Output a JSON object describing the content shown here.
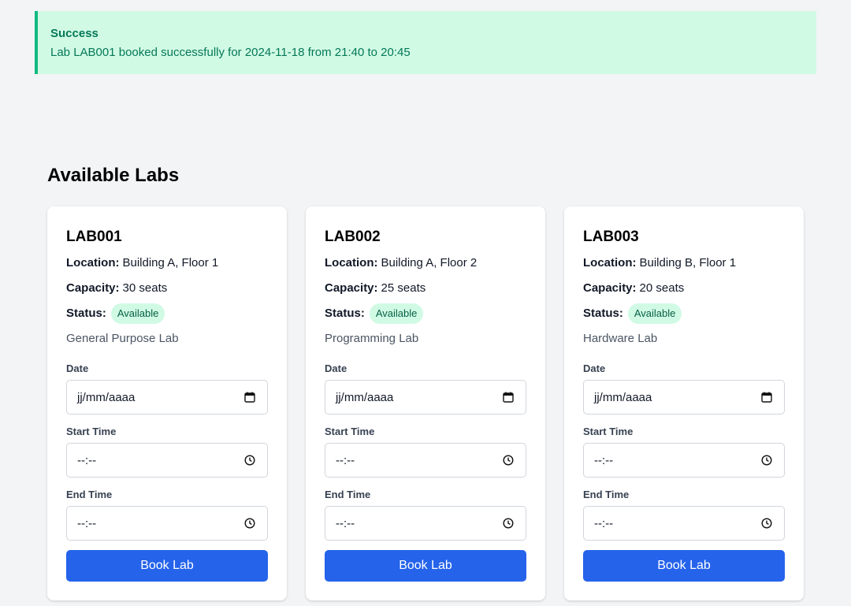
{
  "alert": {
    "title": "Success",
    "message": "Lab LAB001 booked successfully for 2024-11-18 from 21:40 to 20:45"
  },
  "section_title": "Available Labs",
  "labels": {
    "location": "Location:",
    "capacity": "Capacity:",
    "status": "Status:",
    "date": "Date",
    "start_time": "Start Time",
    "end_time": "End Time"
  },
  "labs": [
    {
      "name": "LAB001",
      "location": "Building A, Floor 1",
      "capacity": "30 seats",
      "status": "Available",
      "description": "General Purpose Lab",
      "date_placeholder": "jj/mm/aaaa",
      "start_placeholder": "--:--",
      "end_placeholder": "--:--",
      "button": "Book Lab"
    },
    {
      "name": "LAB002",
      "location": "Building A, Floor 2",
      "capacity": "25 seats",
      "status": "Available",
      "description": "Programming Lab",
      "date_placeholder": "jj/mm/aaaa",
      "start_placeholder": "--:--",
      "end_placeholder": "--:--",
      "button": "Book Lab"
    },
    {
      "name": "LAB003",
      "location": "Building B, Floor 1",
      "capacity": "20 seats",
      "status": "Available",
      "description": "Hardware Lab",
      "date_placeholder": "jj/mm/aaaa",
      "start_placeholder": "--:--",
      "end_placeholder": "--:--",
      "button": "Book Lab"
    }
  ],
  "icons": {
    "date": "calendar-icon",
    "time": "clock-icon"
  },
  "colors": {
    "accent": "#2563eb",
    "success_bg": "#d1fae5",
    "success_border": "#10b981",
    "success_text": "#047857"
  }
}
